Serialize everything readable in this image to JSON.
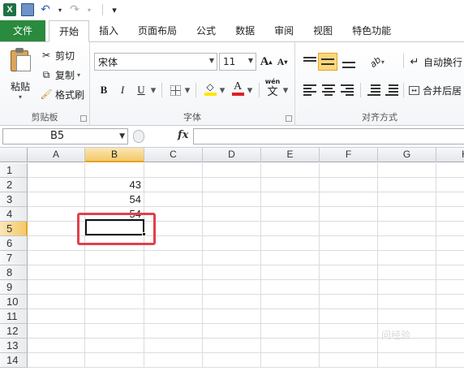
{
  "qat": {
    "logo": "X",
    "undo_icon": "↶",
    "redo_icon": "↷",
    "customize_icon": "▾"
  },
  "tabs": [
    "文件",
    "开始",
    "插入",
    "页面布局",
    "公式",
    "数据",
    "审阅",
    "视图",
    "特色功能"
  ],
  "ribbon": {
    "clipboard": {
      "label": "剪贴板",
      "paste": "粘贴",
      "cut": "剪切",
      "copy": "复制",
      "format_painter": "格式刷"
    },
    "font": {
      "label": "字体",
      "font_name": "宋体",
      "font_size": "11",
      "grow": "A",
      "shrink": "A",
      "bold": "B",
      "italic": "I",
      "underline": "U",
      "font_color_glyph": "A",
      "phonetic_glyph": "wén",
      "phonetic_char": "文"
    },
    "alignment": {
      "label": "对齐方式",
      "wrap_text": "自动换行",
      "merge_center": "合并后居"
    }
  },
  "formula_bar": {
    "name_box": "B5",
    "fx": "fx",
    "value": ""
  },
  "sheet": {
    "columns": [
      "A",
      "B",
      "C",
      "D",
      "E",
      "F",
      "G",
      "H"
    ],
    "selected_column": "B",
    "rows": [
      "1",
      "2",
      "3",
      "4",
      "5",
      "6",
      "7",
      "8",
      "9",
      "10",
      "11",
      "12",
      "13",
      "14"
    ],
    "selected_row": "5",
    "cells": [
      {
        "ref": "B2",
        "value": "43"
      },
      {
        "ref": "B3",
        "value": "54"
      },
      {
        "ref": "B4",
        "value": "54"
      }
    ],
    "active_cell": "B5"
  },
  "colors": {
    "file_tab": "#2a8a3d",
    "selection_header": "#f4c968",
    "highlight_box": "#e0414c",
    "font_color_bar": "#e02020",
    "fill_color_bar": "#ffe600"
  },
  "watermark": "问经验"
}
